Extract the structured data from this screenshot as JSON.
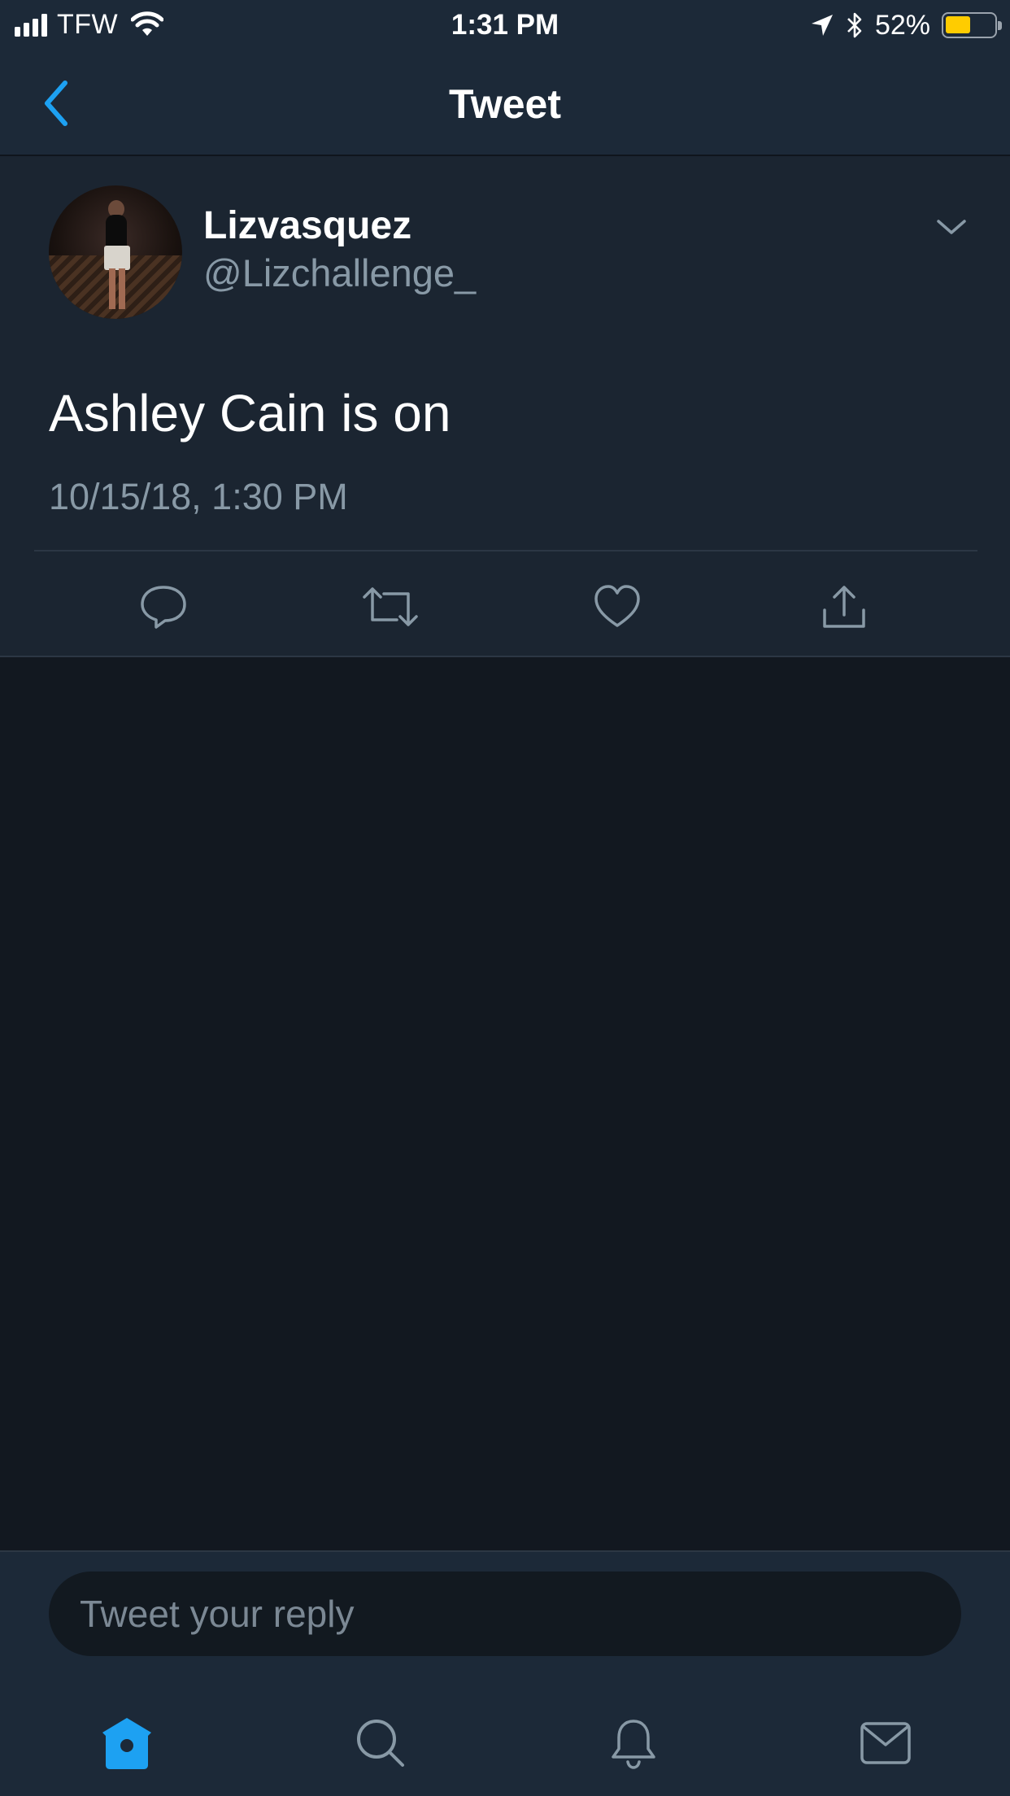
{
  "status_bar": {
    "carrier": "TFW",
    "time": "1:31 PM",
    "battery_percent": "52%",
    "battery_level": 0.52
  },
  "nav": {
    "title": "Tweet",
    "back_icon": "chevron-left-icon"
  },
  "tweet": {
    "display_name": "Lizvasquez",
    "handle": "@Lizchallenge_",
    "text": "Ashley Cain is on",
    "timestamp": "10/15/18, 1:30 PM",
    "actions": [
      "reply-icon",
      "retweet-icon",
      "like-icon",
      "share-icon"
    ]
  },
  "reply": {
    "placeholder": "Tweet your reply"
  },
  "tab_bar": {
    "items": [
      "home-icon",
      "search-icon",
      "notifications-icon",
      "messages-icon"
    ],
    "active": "home-icon"
  },
  "colors": {
    "accent": "#1da1f2",
    "header_bg": "#1c2938",
    "tweet_bg": "#1b2531",
    "empty_bg": "#121820",
    "secondary_text": "#8899a6",
    "battery": "#ffcc00"
  }
}
